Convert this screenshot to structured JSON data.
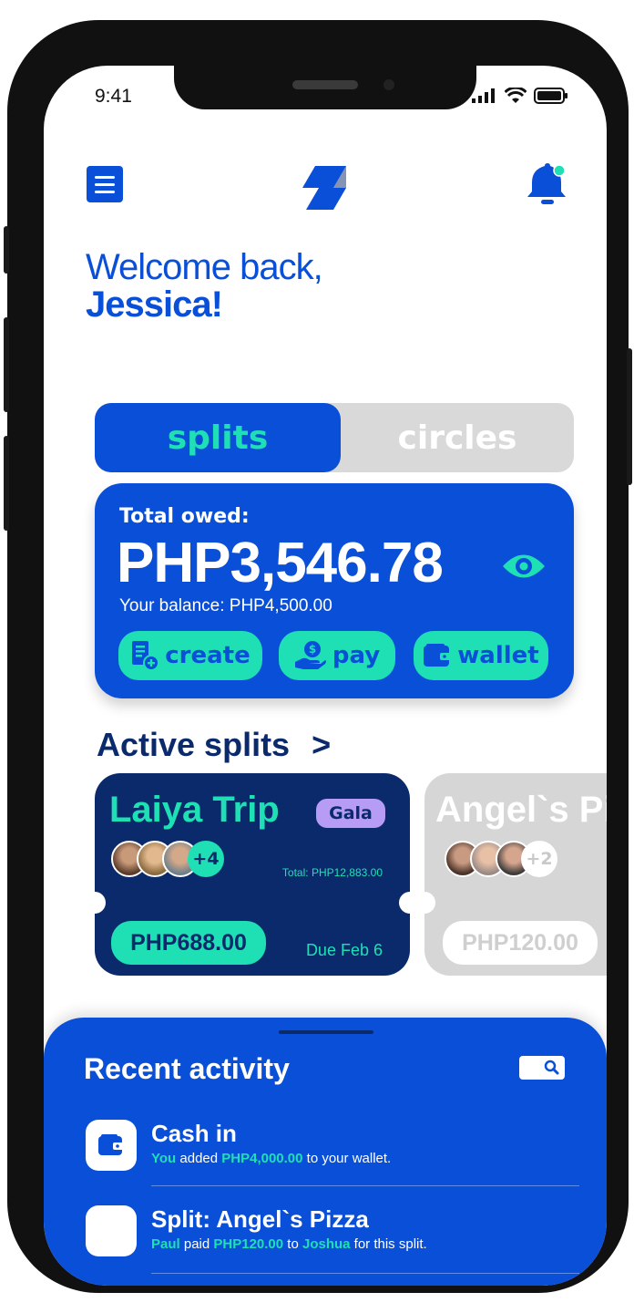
{
  "status_bar": {
    "time": "9:41"
  },
  "header": {
    "menu_icon": "menu-icon",
    "logo_icon": "app-logo",
    "notification_icon": "bell-icon"
  },
  "welcome": {
    "greeting": "Welcome back,",
    "name": "Jessica!"
  },
  "toggle": {
    "active": "splits",
    "inactive": "circles"
  },
  "owed_card": {
    "label": "Total owed:",
    "amount": "PHP3,546.78",
    "balance": "Your balance: PHP4,500.00",
    "actions": [
      {
        "label": "create",
        "icon": "create-bill-icon"
      },
      {
        "label": "pay",
        "icon": "pay-hand-icon"
      },
      {
        "label": "wallet",
        "icon": "wallet-icon"
      }
    ]
  },
  "active_splits": {
    "title": "Active splits",
    "chevron": ">",
    "cards": [
      {
        "name": "Laiya Trip",
        "tag": "Gala",
        "more": "+4",
        "total": "Total: PHP12,883.00",
        "amount": "PHP688.00",
        "due": "Due Feb 6"
      },
      {
        "name": "Angel`s Pi",
        "more": "+2",
        "amount": "PHP120.00"
      }
    ]
  },
  "recent_activity": {
    "title": "Recent activity",
    "items": [
      {
        "title": "Cash in",
        "who": "You",
        "mid": " added ",
        "amount": "PHP4,000.00",
        "tail": " to your wallet."
      },
      {
        "title": "Split: Angel`s Pizza",
        "who": "Paul",
        "mid": " paid ",
        "amount": "PHP120.00",
        "mid2": " to ",
        "to": "Joshua",
        "tail": " for this split."
      }
    ]
  },
  "colors": {
    "primary": "#0a4fd8",
    "accent": "#1fe0b5",
    "navy": "#0b2a6b",
    "tag": "#b79cf5"
  }
}
